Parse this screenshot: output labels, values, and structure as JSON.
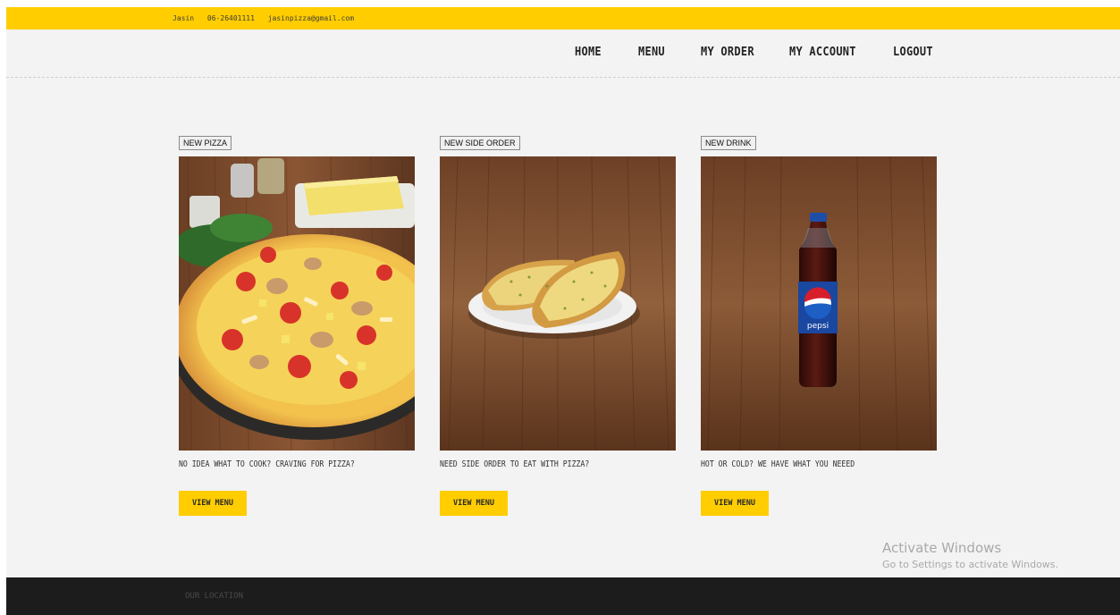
{
  "topbar": {
    "name": "Jasin",
    "phone": "06-26401111",
    "email": "jasinpizza@gmail.com"
  },
  "nav": {
    "items": [
      "HOME",
      "MENU",
      "MY ORDER",
      "MY ACCOUNT",
      "LOGOUT"
    ]
  },
  "cards": [
    {
      "badge": "NEW PIZZA",
      "caption": "NO IDEA WHAT TO COOK? CRAVING FOR PIZZA?",
      "button": "VIEW MENU"
    },
    {
      "badge": "NEW SIDE ORDER",
      "caption": "NEED SIDE ORDER TO EAT WITH PIZZA?",
      "button": "VIEW MENU"
    },
    {
      "badge": "NEW DRINK",
      "caption": "HOT OR COLD? WE HAVE WHAT YOU NEEED",
      "button": "VIEW MENU"
    }
  ],
  "bottle_label": "pepsi",
  "watermark": {
    "title": "Activate Windows",
    "subtitle": "Go to Settings to activate Windows."
  },
  "footer": {
    "label": "OUR LOCATION"
  },
  "colors": {
    "accent": "#ffcd00",
    "background": "#f3f3f3",
    "footer": "#1c1c1c",
    "wood": "#7a4a2c"
  }
}
